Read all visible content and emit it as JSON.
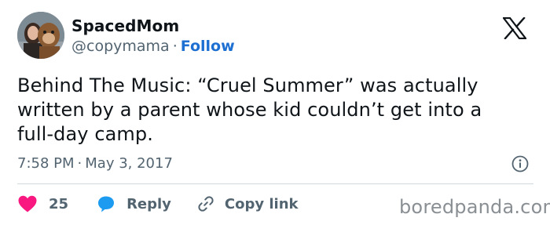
{
  "user": {
    "display_name": "SpacedMom",
    "handle": "@copymama",
    "separator": "·",
    "follow_label": "Follow"
  },
  "tweet": {
    "lines": [
      "Behind The Music: “Cruel Summer” was actually",
      "written by a parent whose kid couldn’t get into a",
      "full-day camp."
    ],
    "time": "7:58 PM",
    "date": "May 3, 2017",
    "separator": "·"
  },
  "actions": {
    "like_count": "25",
    "reply_label": "Reply",
    "copy_link_label": "Copy link"
  },
  "watermark": "boredpanda.com",
  "icons": {
    "logo": "x-logo-icon",
    "info": "info-icon",
    "like": "heart-icon",
    "reply": "speech-bubble-icon",
    "copy": "link-icon"
  },
  "colors": {
    "accent": "#1d6fd2",
    "like": "#f91880",
    "reply": "#1d9bf0",
    "text": "#0f1419",
    "muted": "#536471"
  }
}
